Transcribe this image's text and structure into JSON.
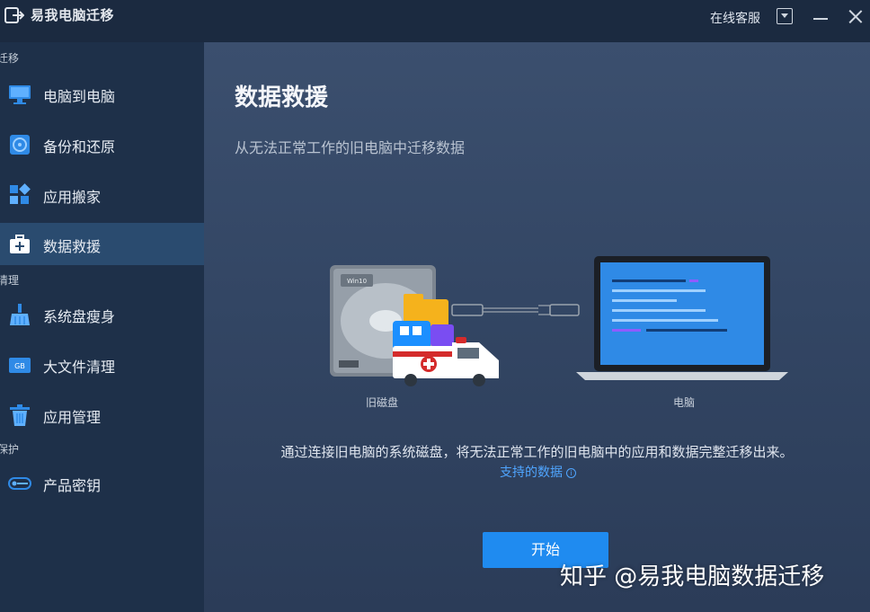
{
  "app": {
    "title": "易我电脑迁移"
  },
  "titlebar": {
    "support": "在线客服"
  },
  "sidebar": {
    "sections": [
      {
        "label": "迁移"
      },
      {
        "label": "清理"
      },
      {
        "label": "保护"
      }
    ],
    "items": [
      {
        "label": "电脑到电脑",
        "icon": "monitor-icon"
      },
      {
        "label": "备份和还原",
        "icon": "backup-disk-icon"
      },
      {
        "label": "应用搬家",
        "icon": "app-blocks-icon"
      },
      {
        "label": "数据救援",
        "icon": "rescue-kit-icon",
        "active": true
      },
      {
        "label": "系统盘瘦身",
        "icon": "broom-icon"
      },
      {
        "label": "大文件清理",
        "icon": "gb-file-icon"
      },
      {
        "label": "应用管理",
        "icon": "trash-icon"
      },
      {
        "label": "产品密钥",
        "icon": "key-icon"
      }
    ]
  },
  "main": {
    "title": "数据救援",
    "subtitle": "从无法正常工作的旧电脑中迁移数据",
    "illustration": {
      "disk_badge": "Win10",
      "disk_caption": "旧磁盘",
      "pc_caption": "电脑"
    },
    "description": "通过连接旧电脑的系统磁盘，将无法正常工作的旧电脑中的应用和数据完整迁移出来。",
    "supported_link": "支持的数据",
    "info_glyph": "i",
    "start_button": "开始"
  },
  "watermark": "知乎 @易我电脑数据迁移",
  "colors": {
    "accent": "#1f8bf0",
    "link": "#4fa5ff",
    "sidebar_bg": "#1e3049",
    "sidebar_active": "#2a4b6f",
    "main_bg": "#3b4f6e"
  }
}
